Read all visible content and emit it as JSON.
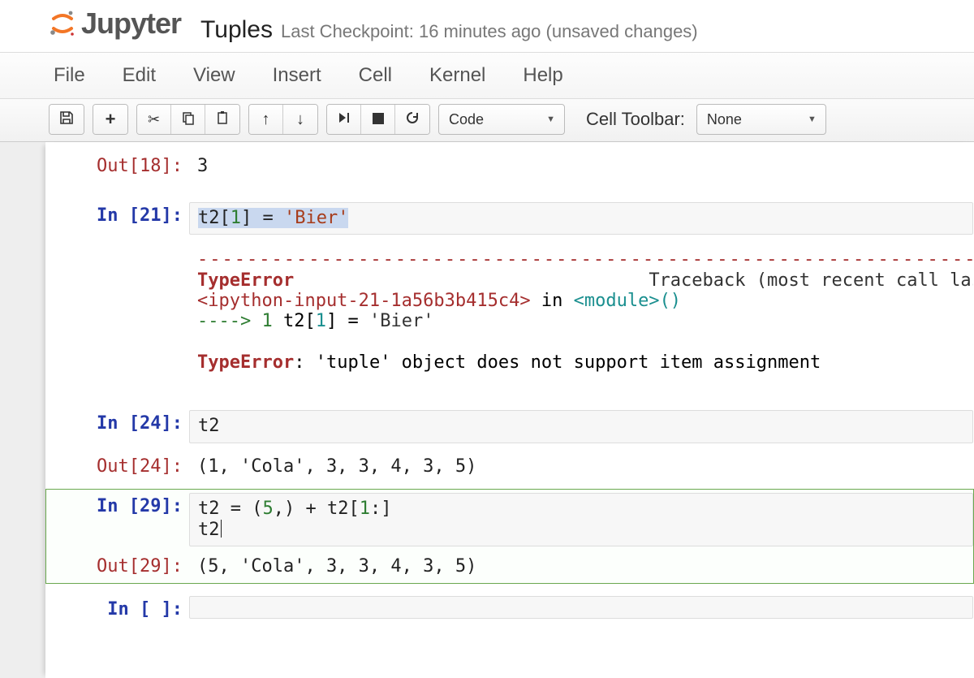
{
  "header": {
    "logo_text": "Jupyter",
    "notebook_title": "Tuples",
    "checkpoint": "Last Checkpoint: 16 minutes ago (unsaved changes)"
  },
  "menubar": [
    "File",
    "Edit",
    "View",
    "Insert",
    "Cell",
    "Kernel",
    "Help"
  ],
  "toolbar": {
    "celltype_selected": "Code",
    "celltoolbar_label": "Cell Toolbar:",
    "celltoolbar_selected": "None"
  },
  "cells": {
    "c0": {
      "out_prompt": "Out[18]:",
      "out_value": "3"
    },
    "c1": {
      "in_prompt": "In [21]:",
      "code_plain": "t2[1] = 'Bier'",
      "code_sel_pre": "t2[",
      "code_sel_num": "1",
      "code_sel_mid": "] = ",
      "code_sel_str": "'Bier'",
      "tb_dash": "---------------------------------------------------------------------------",
      "tb_err": "TypeError",
      "tb_trace_label": "Traceback (most recent call last)",
      "tb_loc_open": "<ipython-input-21-1a56b3b415c4>",
      "tb_loc_in": " in ",
      "tb_loc_mod": "<module>",
      "tb_loc_tail": "()",
      "tb_arrow": "----> 1 ",
      "tb_line_code_pre": "t2",
      "tb_line_code_br": "[",
      "tb_line_code_num": "1",
      "tb_line_code_br2": "]",
      "tb_line_code_eq": " = ",
      "tb_line_code_str": "'Bier'",
      "tb_final_err": "TypeError",
      "tb_final_colon": ": ",
      "tb_final_msg": "'tuple' object does not support item assignment"
    },
    "c2": {
      "in_prompt": "In [24]:",
      "code": "t2",
      "out_prompt": "Out[24]:",
      "out_value": "(1, 'Cola', 3, 3, 4, 3, 5)"
    },
    "c3": {
      "in_prompt": "In [29]:",
      "code": "t2 = (5,) + t2[1:]\nt2",
      "out_prompt": "Out[29]:",
      "out_value": "(5, 'Cola', 3, 3, 4, 3, 5)"
    },
    "c4": {
      "in_prompt": "In [ ]:",
      "code": ""
    }
  }
}
